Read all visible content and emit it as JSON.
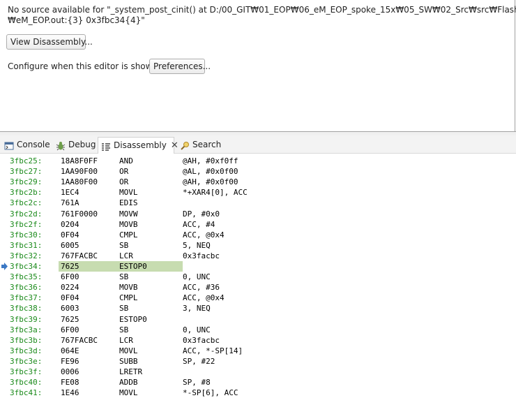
{
  "editor": {
    "nosrc_line1": "No source available for \"_system_post_cinit() at D:/00_GIT₩01_EOP₩06_eM_EOP_spoke_15x₩05_SW₩02_Src₩src₩Flash_Lib",
    "nosrc_line2": "₩eM_EOP.out:{3} 0x3fbc34{4}\"",
    "view_disassembly_label": "View Disassembly...",
    "configure_label": "Configure when this editor is shown",
    "preferences_label": "Preferences..."
  },
  "tabs": [
    {
      "label": "Console",
      "icon": "console-icon"
    },
    {
      "label": "Debug",
      "icon": "debug-icon"
    },
    {
      "label": "Disassembly",
      "icon": "disassembly-icon",
      "active": true
    },
    {
      "label": "Search",
      "icon": "search-icon"
    }
  ],
  "colors": {
    "address": "#1a8a1a",
    "current_line_highlight": "#c7dcb0",
    "pointer": "#3b78c4"
  },
  "rows": [
    {
      "addr": "3fbc25:",
      "op": "18A8F0FF",
      "mn": "AND",
      "args": "@AH, #0xf0ff"
    },
    {
      "addr": "3fbc27:",
      "op": "1AA90F00",
      "mn": "OR",
      "args": "@AL, #0x0f00"
    },
    {
      "addr": "3fbc29:",
      "op": "1AA80F00",
      "mn": "OR",
      "args": "@AH, #0x0f00"
    },
    {
      "addr": "3fbc2b:",
      "op": "1EC4",
      "mn": "MOVL",
      "args": "*+XAR4[0], ACC"
    },
    {
      "addr": "3fbc2c:",
      "op": "761A",
      "mn": "EDIS",
      "args": ""
    },
    {
      "addr": "3fbc2d:",
      "op": "761F0000",
      "mn": "MOVW",
      "args": "DP, #0x0"
    },
    {
      "addr": "3fbc2f:",
      "op": "0204",
      "mn": "MOVB",
      "args": "ACC, #4"
    },
    {
      "addr": "3fbc30:",
      "op": "0F04",
      "mn": "CMPL",
      "args": "ACC, @0x4"
    },
    {
      "addr": "3fbc31:",
      "op": "6005",
      "mn": "SB",
      "args": "5, NEQ"
    },
    {
      "addr": "3fbc32:",
      "op": "767FACBC",
      "mn": "LCR",
      "args": "0x3facbc"
    },
    {
      "addr": "3fbc34:",
      "op": "7625",
      "mn": "ESTOP0",
      "args": "",
      "current": true
    },
    {
      "addr": "3fbc35:",
      "op": "6F00",
      "mn": "SB",
      "args": "0, UNC"
    },
    {
      "addr": "3fbc36:",
      "op": "0224",
      "mn": "MOVB",
      "args": "ACC, #36"
    },
    {
      "addr": "3fbc37:",
      "op": "0F04",
      "mn": "CMPL",
      "args": "ACC, @0x4"
    },
    {
      "addr": "3fbc38:",
      "op": "6003",
      "mn": "SB",
      "args": "3, NEQ"
    },
    {
      "addr": "3fbc39:",
      "op": "7625",
      "mn": "ESTOP0",
      "args": ""
    },
    {
      "addr": "3fbc3a:",
      "op": "6F00",
      "mn": "SB",
      "args": "0, UNC"
    },
    {
      "addr": "3fbc3b:",
      "op": "767FACBC",
      "mn": "LCR",
      "args": "0x3facbc"
    },
    {
      "addr": "3fbc3d:",
      "op": "064E",
      "mn": "MOVL",
      "args": "ACC, *-SP[14]"
    },
    {
      "addr": "3fbc3e:",
      "op": "FE96",
      "mn": "SUBB",
      "args": "SP, #22"
    },
    {
      "addr": "3fbc3f:",
      "op": "0006",
      "mn": "LRETR",
      "args": ""
    },
    {
      "addr": "3fbc40:",
      "op": "FE08",
      "mn": "ADDB",
      "args": "SP, #8"
    },
    {
      "addr": "3fbc41:",
      "op": "1E46",
      "mn": "MOVL",
      "args": "*-SP[6], ACC"
    }
  ]
}
